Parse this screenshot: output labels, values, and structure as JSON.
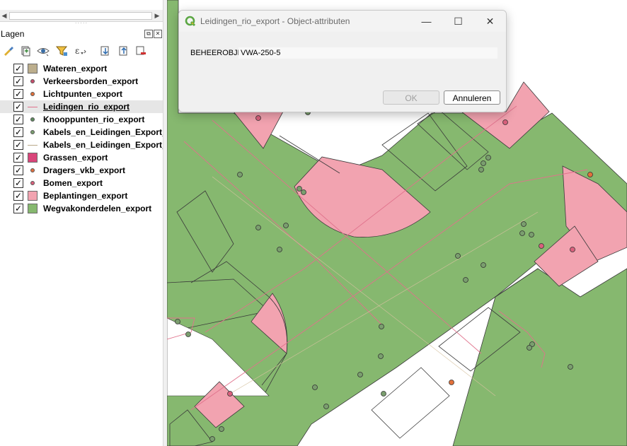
{
  "layers_panel": {
    "title": "Lagen",
    "header_buttons": [
      "float-icon",
      "close-icon"
    ],
    "toolbar_icons": [
      "style-brush-icon",
      "add-group-icon",
      "eye-visibility-icon",
      "filter-icon",
      "expression-filter-icon",
      "expand-all-icon",
      "collapse-all-icon",
      "remove-layer-icon"
    ],
    "layers": [
      {
        "name": "Wateren_export",
        "checked": true,
        "symbol": "fill",
        "color": "#bcae8d"
      },
      {
        "name": "Verkeersborden_export",
        "checked": true,
        "symbol": "dot",
        "color": "#c94f6d"
      },
      {
        "name": "Lichtpunten_export",
        "checked": true,
        "symbol": "dot",
        "color": "#e2703a"
      },
      {
        "name": "Leidingen_rio_export",
        "checked": true,
        "symbol": "line",
        "color": "#e0728c",
        "selected": true
      },
      {
        "name": "Knooppunten_rio_export",
        "checked": true,
        "symbol": "dot",
        "color": "#5e8a5e"
      },
      {
        "name": "Kabels_en_Leidingen_Export_p",
        "checked": true,
        "symbol": "dot",
        "color": "#7a9e6e"
      },
      {
        "name": "Kabels_en_Leidingen_Export_lij",
        "checked": true,
        "symbol": "line",
        "color": "#b9a98a"
      },
      {
        "name": "Grassen_export",
        "checked": true,
        "symbol": "fill",
        "color": "#d9457a"
      },
      {
        "name": "Dragers_vkb_export",
        "checked": true,
        "symbol": "dot",
        "color": "#e07040"
      },
      {
        "name": "Bomen_export",
        "checked": true,
        "symbol": "dot",
        "color": "#d9607c"
      },
      {
        "name": "Beplantingen_export",
        "checked": true,
        "symbol": "fill",
        "color": "#f2a3b0"
      },
      {
        "name": "Wegvakonderdelen_export",
        "checked": true,
        "symbol": "fill",
        "color": "#86b86f"
      }
    ]
  },
  "dialog": {
    "title": "Leidingen_rio_export - Object-attributen",
    "field_label": "BEHEEROBJE",
    "field_value": "VWA-250-5",
    "ok_label": "OK",
    "cancel_label": "Annuleren",
    "minimize_glyph": "—",
    "maximize_glyph": "☐",
    "close_glyph": "✕"
  },
  "map_colors": {
    "road": "#86b86f",
    "planting": "#f2a3b0",
    "pipe": "#e0728c",
    "node": "#7a9e6e",
    "light": "#e2703a"
  }
}
